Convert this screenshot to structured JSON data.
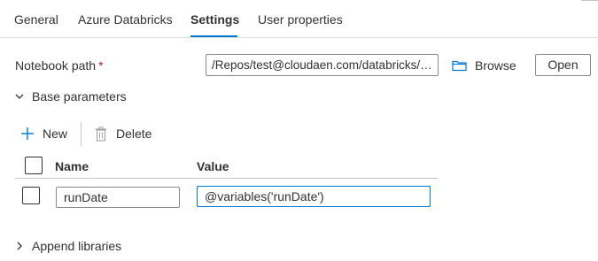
{
  "tabs": [
    {
      "label": "General",
      "active": false
    },
    {
      "label": "Azure Databricks",
      "active": false
    },
    {
      "label": "Settings",
      "active": true
    },
    {
      "label": "User properties",
      "active": false
    }
  ],
  "notebook": {
    "label": "Notebook path",
    "required_mark": "*",
    "path_value": "/Repos/test@cloudaen.com/databricks/u...",
    "browse_label": "Browse",
    "open_label": "Open"
  },
  "base_parameters": {
    "title": "Base parameters",
    "expanded": true,
    "toolbar": {
      "new_label": "New",
      "delete_label": "Delete"
    },
    "columns": {
      "name": "Name",
      "value": "Value"
    },
    "rows": [
      {
        "name": "runDate",
        "value": "@variables('runDate')"
      }
    ]
  },
  "append_libraries": {
    "title": "Append libraries",
    "expanded": false
  },
  "colors": {
    "accent": "#0078d4",
    "required": "#a4262c",
    "text": "#323130",
    "border": "#8a8886"
  }
}
